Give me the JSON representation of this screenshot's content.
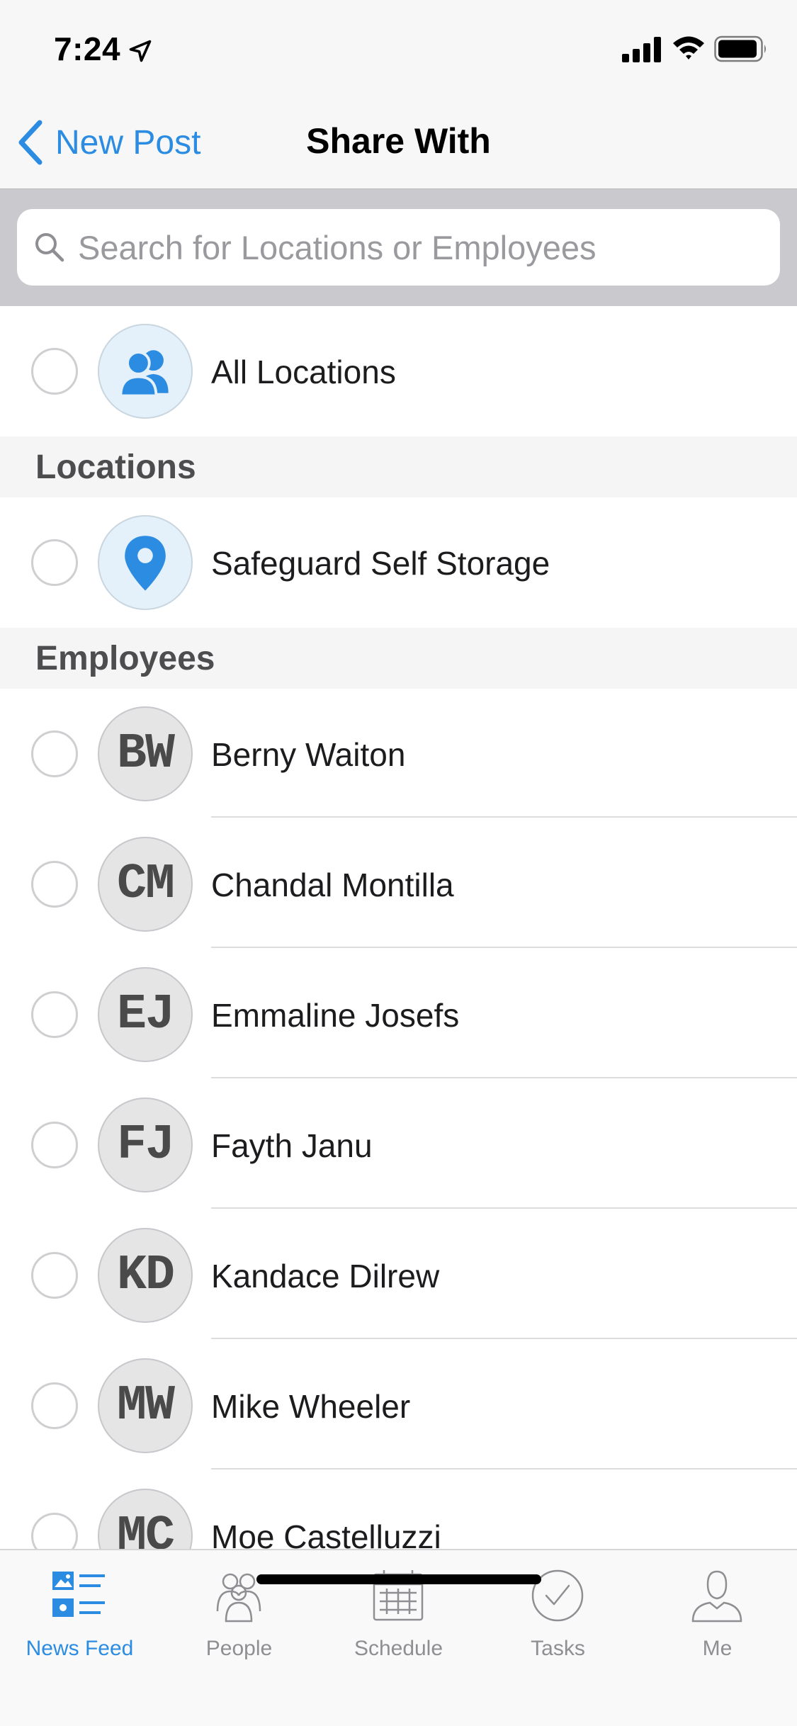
{
  "status_bar": {
    "time": "7:24"
  },
  "nav": {
    "back_label": "New Post",
    "title": "Share With"
  },
  "search": {
    "placeholder": "Search for Locations or Employees",
    "value": ""
  },
  "all_locations": {
    "label": "All Locations",
    "icon": "people-group-icon"
  },
  "sections": {
    "locations": "Locations",
    "employees": "Employees"
  },
  "locations": [
    {
      "name": "Safeguard Self Storage",
      "icon": "location-pin-icon"
    }
  ],
  "employees": [
    {
      "initials": "BW",
      "name": "Berny Waiton"
    },
    {
      "initials": "CM",
      "name": "Chandal Montilla"
    },
    {
      "initials": "EJ",
      "name": "Emmaline Josefs"
    },
    {
      "initials": "FJ",
      "name": "Fayth Janu"
    },
    {
      "initials": "KD",
      "name": "Kandace Dilrew"
    },
    {
      "initials": "MW",
      "name": "Mike Wheeler"
    },
    {
      "initials": "MC",
      "name": "Moe Castelluzzi"
    }
  ],
  "tabs": [
    {
      "label": "News Feed",
      "icon": "news-feed-icon",
      "active": true
    },
    {
      "label": "People",
      "icon": "people-icon",
      "active": false
    },
    {
      "label": "Schedule",
      "icon": "calendar-icon",
      "active": false
    },
    {
      "label": "Tasks",
      "icon": "checkmark-circle-icon",
      "active": false
    },
    {
      "label": "Me",
      "icon": "person-icon",
      "active": false
    }
  ],
  "colors": {
    "accent": "#2b8ce2",
    "inactive_tab": "#8e8e93",
    "avatar_gray": "#e5e5e5",
    "avatar_blue": "#e4f1fb"
  }
}
